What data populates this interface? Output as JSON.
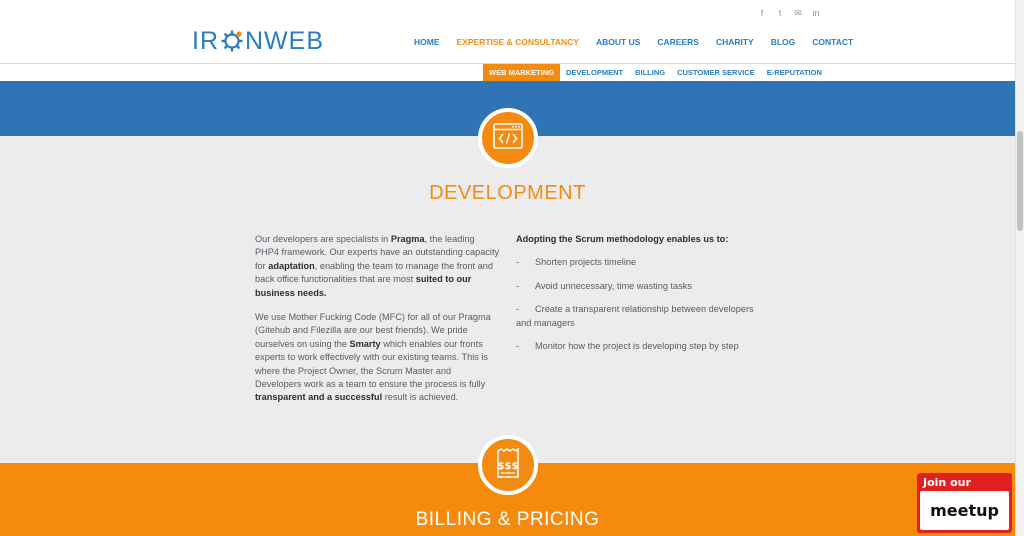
{
  "header": {
    "logo_text_left": "IR",
    "logo_text_right": "NWEB",
    "social_icons": [
      "facebook-icon",
      "twitter-icon",
      "mail-icon",
      "linkedin-icon"
    ],
    "social_glyphs": [
      "f",
      "t",
      "✉",
      "in"
    ],
    "nav": [
      {
        "label": "HOME",
        "active": false
      },
      {
        "label": "EXPERTISE & CONSULTANCY",
        "active": true
      },
      {
        "label": "ABOUT US",
        "active": false
      },
      {
        "label": "CAREERS",
        "active": false
      },
      {
        "label": "CHARITY",
        "active": false
      },
      {
        "label": "BLOG",
        "active": false
      },
      {
        "label": "CONTACT",
        "active": false
      }
    ]
  },
  "subnav": [
    {
      "label": "WEB MARKETING",
      "active": true
    },
    {
      "label": "DEVELOPMENT",
      "active": false
    },
    {
      "label": "BILLING",
      "active": false
    },
    {
      "label": "CUSTOMER SERVICE",
      "active": false
    },
    {
      "label": "E-REPUTATION",
      "active": false
    }
  ],
  "development": {
    "icon": "code-window-icon",
    "title": "DEVELOPMENT",
    "para1": {
      "t1": "Our developers are specialists in ",
      "b1": "Pragma",
      "t2": ", the leading PHP4 framework. Our experts have an outstanding capacity for ",
      "b2": "adaptation",
      "t3": ", enabling the team to manage the front and back office functionalities that are most ",
      "b3": "suited to our business needs."
    },
    "para2": {
      "t1": "We use Mother Fucking Code (MFC) for all of our Pragma (Gitehub and Filezilla are our best friends). We pride ourselves on using the ",
      "b1": "Smarty",
      "t2": " which enables our fronts experts to work effectively with our existing teams. This is where the Project Owner, the Scrum Master and Developers work as a team to ensure the process is fully ",
      "b2": "transparent and a successful",
      "t3": " result is achieved."
    },
    "scrum_title": "Adopting the Scrum methodology enables us to:",
    "scrum_items": [
      "Shorten projects timeline",
      "Avoid unnecessary, time wasting tasks",
      "Create a transparent relationship between developers and managers",
      "Monitor how the project is developing step by step"
    ],
    "dash": "-"
  },
  "billing": {
    "icon": "billing-receipt-icon",
    "title": "BILLING & PRICING"
  },
  "meetup": {
    "top": "Join our",
    "bottom": "meetup"
  },
  "colors": {
    "orange": "#f28b10",
    "blue": "#2f75b5",
    "nav_blue": "#2a7dc2"
  }
}
